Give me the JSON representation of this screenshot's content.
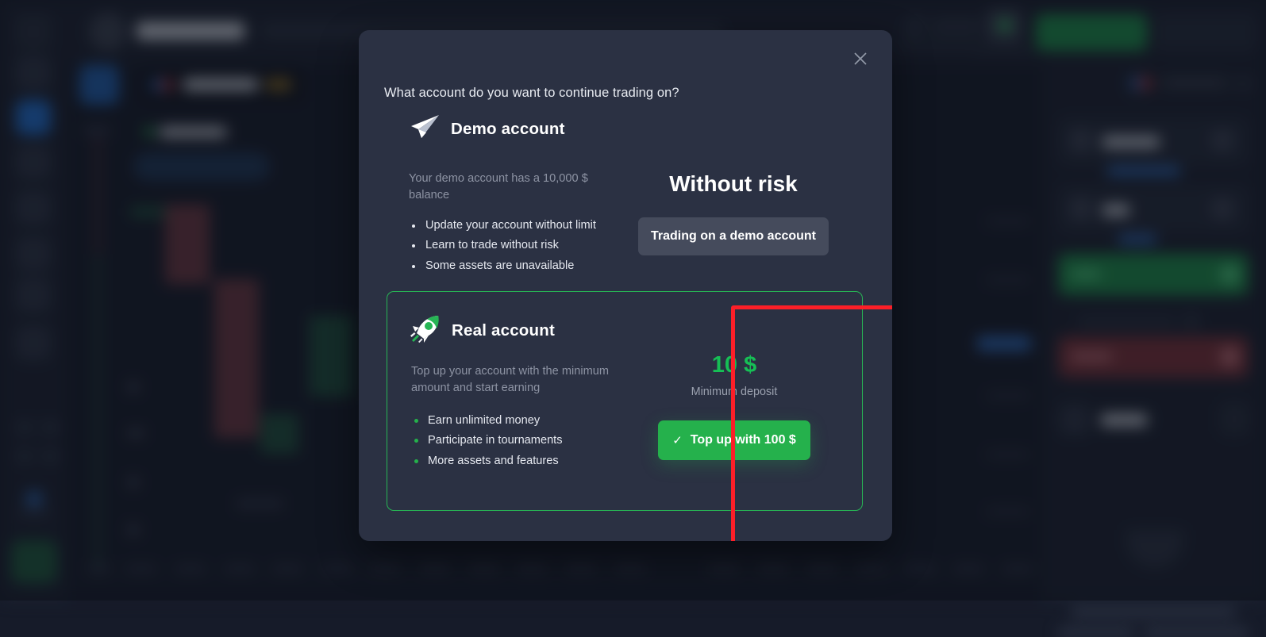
{
  "modal": {
    "title": "What account do you want to continue trading on?",
    "close_icon": "close-icon"
  },
  "demo": {
    "icon": "paper-plane-icon",
    "title": "Demo account",
    "description": "Your demo account has a 10,000 $ balance",
    "features": [
      "Update your account without limit",
      "Learn to trade without risk",
      "Some assets are unavailable"
    ],
    "headline": "Without risk",
    "cta_label": "Trading on a demo account"
  },
  "real": {
    "icon": "rocket-icon",
    "title": "Real account",
    "description": "Top up your account with the minimum amount and start earning",
    "features": [
      "Earn unlimited money",
      "Participate in tournaments",
      "More assets and features"
    ],
    "deposit_amount": "10 $",
    "deposit_label": "Minimum deposit",
    "cta_check_icon": "check-icon",
    "cta_label": "Top up with 100 $"
  },
  "colors": {
    "accent_green": "#25b14c",
    "bright_green": "#16bf55",
    "highlight_red": "#fc1f28",
    "modal_bg": "#2b3143",
    "demo_button": "#454b5c"
  }
}
